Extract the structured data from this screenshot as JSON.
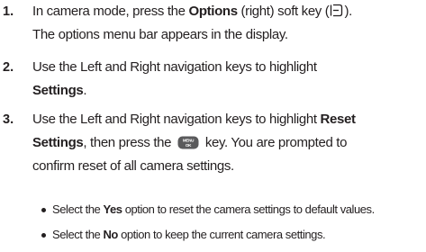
{
  "steps": [
    {
      "number": "1.",
      "line1_pre": "In camera mode, press the ",
      "line1_bold": "Options",
      "line1_post": " (right) soft key (",
      "line1_end": ").",
      "icon": "right-soft-key-icon",
      "line2": "The options menu bar appears in the display."
    },
    {
      "number": "2.",
      "line1": "Use the Left and Right navigation keys to highlight",
      "line2_bold": "Settings",
      "line2_end": "."
    },
    {
      "number": "3.",
      "line1_pre": "Use the Left and Right navigation keys to highlight ",
      "line1_bold": "Reset",
      "line2_bold": "Settings",
      "line2_mid": ", then press the ",
      "key_icon": "menu-ok-key-icon",
      "key_icon_text_top": "MENU",
      "key_icon_text_bottom": "OK",
      "line2_end": " key. You are prompted to",
      "line3": "confirm reset of all camera settings."
    }
  ],
  "bullets": [
    {
      "pre": "Select the ",
      "bold": "Yes",
      "post": " option to reset the camera settings to default values."
    },
    {
      "pre": "Select the ",
      "bold": "No",
      "post": " option to keep the current camera settings."
    }
  ],
  "colors": {
    "text": "#231f20",
    "key_fill": "#5a5a5c"
  }
}
